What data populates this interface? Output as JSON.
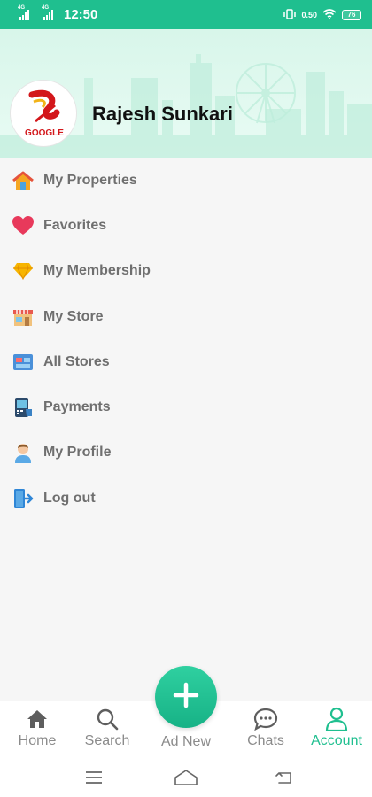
{
  "status_bar": {
    "time": "12:50",
    "network_left_1": "4G",
    "network_left_2": "4G",
    "speed": "0.50",
    "battery": "76"
  },
  "header": {
    "user_name": "Rajesh Sunkari",
    "logo_text": "GOOGLE"
  },
  "menu": {
    "items": [
      {
        "label": "My Properties",
        "icon": "house-icon"
      },
      {
        "label": "Favorites",
        "icon": "heart-icon"
      },
      {
        "label": "My Membership",
        "icon": "diamond-icon"
      },
      {
        "label": "My Store",
        "icon": "storefront-icon"
      },
      {
        "label": "All Stores",
        "icon": "stores-icon"
      },
      {
        "label": "Payments",
        "icon": "payment-icon"
      },
      {
        "label": "My Profile",
        "icon": "profile-icon"
      },
      {
        "label": "Log out",
        "icon": "logout-icon"
      }
    ]
  },
  "bottom_nav": {
    "home": "Home",
    "search": "Search",
    "ad_new": "Ad New",
    "chats": "Chats",
    "account": "Account",
    "active": "account"
  },
  "colors": {
    "accent": "#1fbf8f",
    "text_muted": "#6f6f6f"
  }
}
